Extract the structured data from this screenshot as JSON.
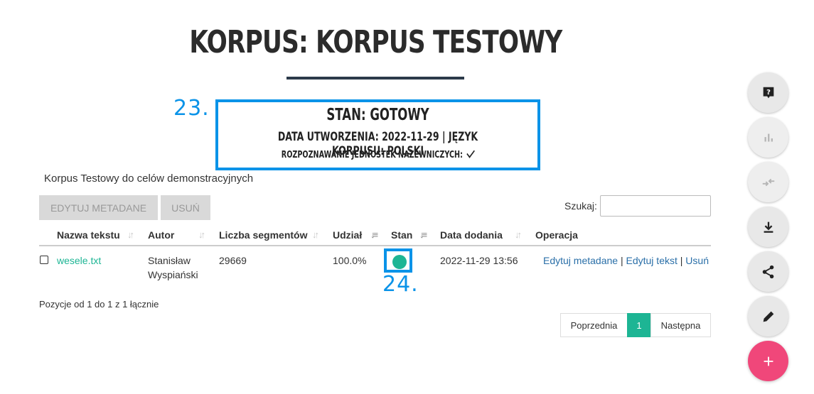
{
  "page": {
    "title": "KORPUS: KORPUS TESTOWY"
  },
  "annotations": {
    "status_number": "23.",
    "state_number": "24."
  },
  "status": {
    "state": "STAN: GOTOWY",
    "meta": "DATA UTWORZENIA: 2022-11-29 | JĘZYK KORPUSU: POLSKI",
    "ner": "ROZPOZNAWANIE JEDNOSTEK NAZEWNICZYCH:"
  },
  "description": "Korpus Testowy do celów demonstracyjnych",
  "toolbar": {
    "edit_metadata_label": "EDYTUJ METADANE",
    "delete_label": "USUŃ"
  },
  "search": {
    "label": "Szukaj:",
    "value": ""
  },
  "table": {
    "headers": [
      "Nazwa tekstu",
      "Autor",
      "Liczba segmentów",
      "Udział",
      "Stan",
      "Data dodania",
      "Operacja"
    ],
    "rows": [
      {
        "name": "wesele.txt",
        "author_line1": "Stanisław",
        "author_line2": "Wyspiański",
        "segments": "29669",
        "share": "100.0%",
        "state_color": "#1db594",
        "date": "2022-11-29 13:56",
        "op_edit_meta": "Edytuj metadane",
        "op_edit_text": "Edytuj tekst",
        "op_delete": "Usuń"
      }
    ]
  },
  "footer": {
    "info": "Pozycje od 1 do 1 z 1 łącznie"
  },
  "pagination": {
    "prev": "Poprzednia",
    "current": "1",
    "next": "Następna"
  },
  "side_buttons": [
    "help-icon",
    "chart-icon",
    "compare-icon",
    "download-icon",
    "share-icon",
    "pencil-icon",
    "plus-icon"
  ],
  "colors": {
    "accent": "#1db594",
    "annotation": "#0a93e8",
    "add_button": "#f0477a",
    "link": "#2a6fa8"
  }
}
